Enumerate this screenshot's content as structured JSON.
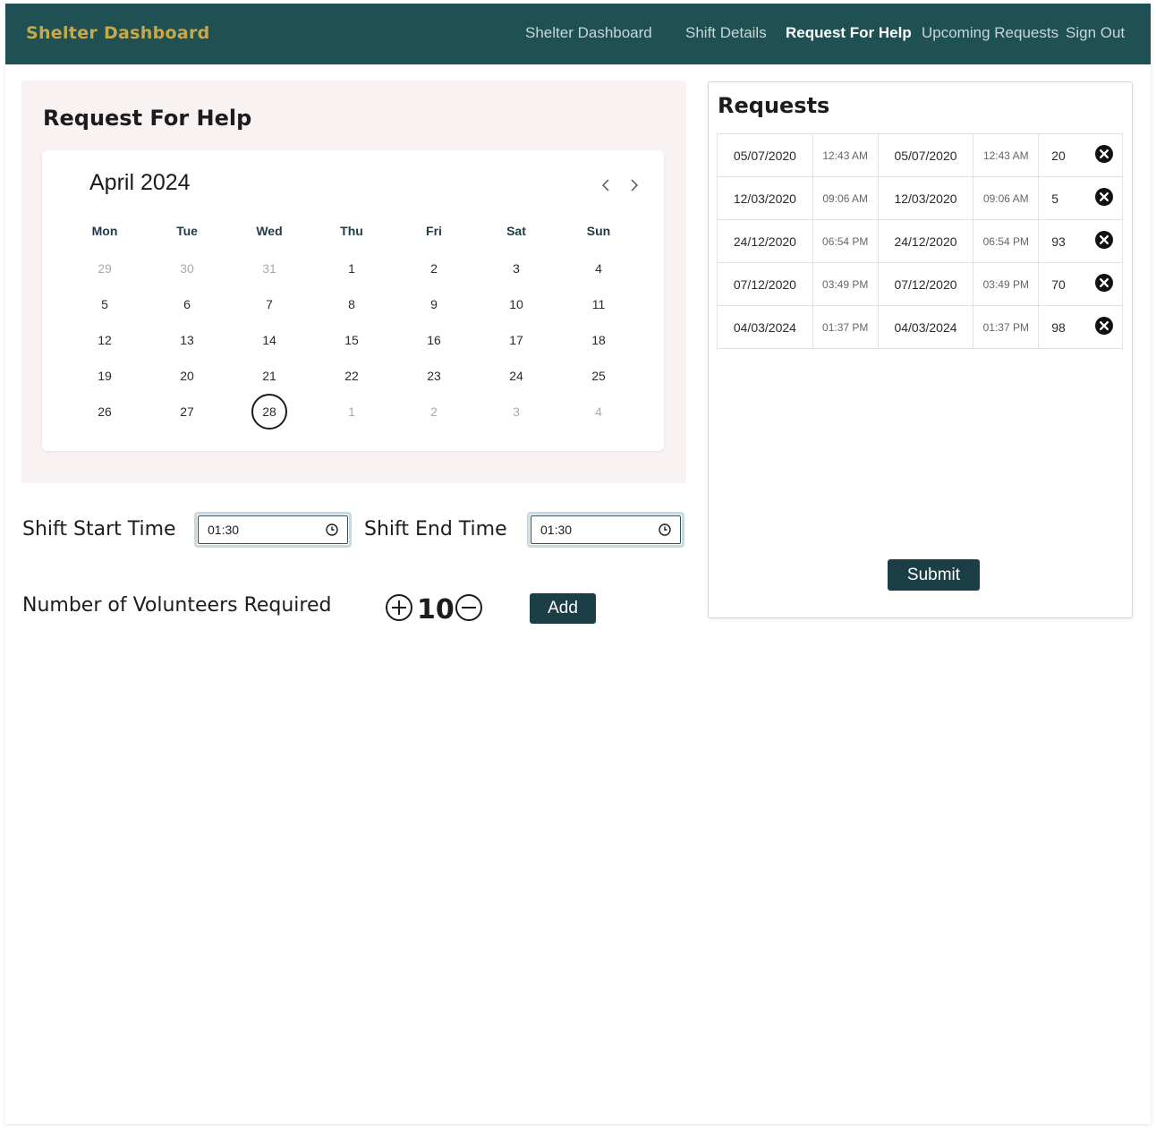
{
  "nav": {
    "brand": "Shelter Dashboard",
    "links": [
      {
        "label": "Shelter Dashboard",
        "active": false
      },
      {
        "label": "Shift Details",
        "active": false
      },
      {
        "label": "Request For Help",
        "active": true
      },
      {
        "label": "Upcoming Requests",
        "active": false
      },
      {
        "label": "Sign Out",
        "active": false
      }
    ]
  },
  "request": {
    "title": "Request For Help",
    "calendar": {
      "month_label": "April 2024",
      "weekdays": [
        "Mon",
        "Tue",
        "Wed",
        "Thu",
        "Fri",
        "Sat",
        "Sun"
      ],
      "weeks": [
        [
          {
            "d": "29",
            "m": true
          },
          {
            "d": "30",
            "m": true
          },
          {
            "d": "31",
            "m": true
          },
          {
            "d": "1"
          },
          {
            "d": "2"
          },
          {
            "d": "3"
          },
          {
            "d": "4"
          }
        ],
        [
          {
            "d": "5"
          },
          {
            "d": "6"
          },
          {
            "d": "7"
          },
          {
            "d": "8"
          },
          {
            "d": "9"
          },
          {
            "d": "10"
          },
          {
            "d": "11"
          }
        ],
        [
          {
            "d": "12"
          },
          {
            "d": "13"
          },
          {
            "d": "14"
          },
          {
            "d": "15"
          },
          {
            "d": "16"
          },
          {
            "d": "17"
          },
          {
            "d": "18"
          }
        ],
        [
          {
            "d": "19"
          },
          {
            "d": "20"
          },
          {
            "d": "21"
          },
          {
            "d": "22"
          },
          {
            "d": "23"
          },
          {
            "d": "24"
          },
          {
            "d": "25"
          }
        ],
        [
          {
            "d": "26"
          },
          {
            "d": "27"
          },
          {
            "d": "28",
            "selected": true
          },
          {
            "d": "1",
            "m": true
          },
          {
            "d": "2",
            "m": true
          },
          {
            "d": "3",
            "m": true
          },
          {
            "d": "4",
            "m": true
          }
        ]
      ]
    },
    "shift_start_label": "Shift Start Time",
    "shift_start_value": "01:30",
    "shift_end_label": "Shift End Time",
    "shift_end_value": "01:30",
    "volunteers_label": "Number of Volunteers Required",
    "volunteers_count": "10",
    "add_label": "Add"
  },
  "requests": {
    "title": "Requests",
    "rows": [
      [
        "05/07/2020",
        "12:43 AM",
        "05/07/2020",
        "12:43 AM",
        "20"
      ],
      [
        "12/03/2020",
        "09:06 AM",
        "12/03/2020",
        "09:06 AM",
        "5"
      ],
      [
        "24/12/2020",
        "06:54 PM",
        "24/12/2020",
        "06:54 PM",
        "93"
      ],
      [
        "07/12/2020",
        "03:49 PM",
        "07/12/2020",
        "03:49 PM",
        "70"
      ],
      [
        "04/03/2024",
        "01:37 PM",
        "04/03/2024",
        "01:37 PM",
        "98"
      ]
    ],
    "submit_label": "Submit"
  }
}
